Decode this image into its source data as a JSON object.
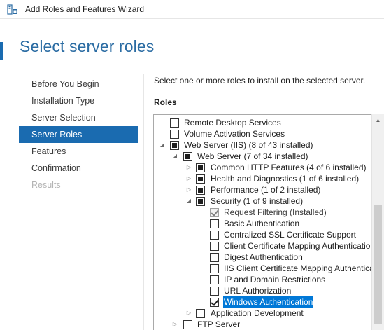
{
  "window": {
    "title": "Add Roles and Features Wizard",
    "icon": "server-manager-icon"
  },
  "page_title": "Select server roles",
  "nav": {
    "items": [
      {
        "label": "Before You Begin",
        "state": "normal"
      },
      {
        "label": "Installation Type",
        "state": "normal"
      },
      {
        "label": "Server Selection",
        "state": "normal"
      },
      {
        "label": "Server Roles",
        "state": "active"
      },
      {
        "label": "Features",
        "state": "normal"
      },
      {
        "label": "Confirmation",
        "state": "normal"
      },
      {
        "label": "Results",
        "state": "disabled"
      }
    ]
  },
  "main": {
    "instruction": "Select one or more roles to install on the selected server.",
    "roles_heading": "Roles",
    "tree": [
      {
        "label": "Remote Desktop Services",
        "state": "unchecked"
      },
      {
        "label": "Volume Activation Services",
        "state": "unchecked"
      },
      {
        "label": "Web Server (IIS) (8 of 43 installed)",
        "state": "indeterminate",
        "expanded": true
      },
      {
        "label": "Web Server (7 of 34 installed)",
        "state": "indeterminate",
        "expanded": true
      },
      {
        "label": "Common HTTP Features (4 of 6 installed)",
        "state": "indeterminate",
        "expanded": false
      },
      {
        "label": "Health and Diagnostics (1 of 6 installed)",
        "state": "indeterminate",
        "expanded": false
      },
      {
        "label": "Performance (1 of 2 installed)",
        "state": "indeterminate",
        "expanded": false
      },
      {
        "label": "Security (1 of 9 installed)",
        "state": "indeterminate",
        "expanded": true
      },
      {
        "label": "Request Filtering (Installed)",
        "state": "checked-disabled"
      },
      {
        "label": "Basic Authentication",
        "state": "unchecked"
      },
      {
        "label": "Centralized SSL Certificate Support",
        "state": "unchecked"
      },
      {
        "label": "Client Certificate Mapping Authentication",
        "state": "unchecked"
      },
      {
        "label": "Digest Authentication",
        "state": "unchecked"
      },
      {
        "label": "IIS Client Certificate Mapping Authentication",
        "state": "unchecked"
      },
      {
        "label": "IP and Domain Restrictions",
        "state": "unchecked"
      },
      {
        "label": "URL Authorization",
        "state": "unchecked"
      },
      {
        "label": "Windows Authentication",
        "state": "checked",
        "selected": true
      },
      {
        "label": "Application Development",
        "state": "unchecked",
        "expanded": false
      },
      {
        "label": "FTP Server",
        "state": "unchecked",
        "expanded": false
      }
    ]
  }
}
